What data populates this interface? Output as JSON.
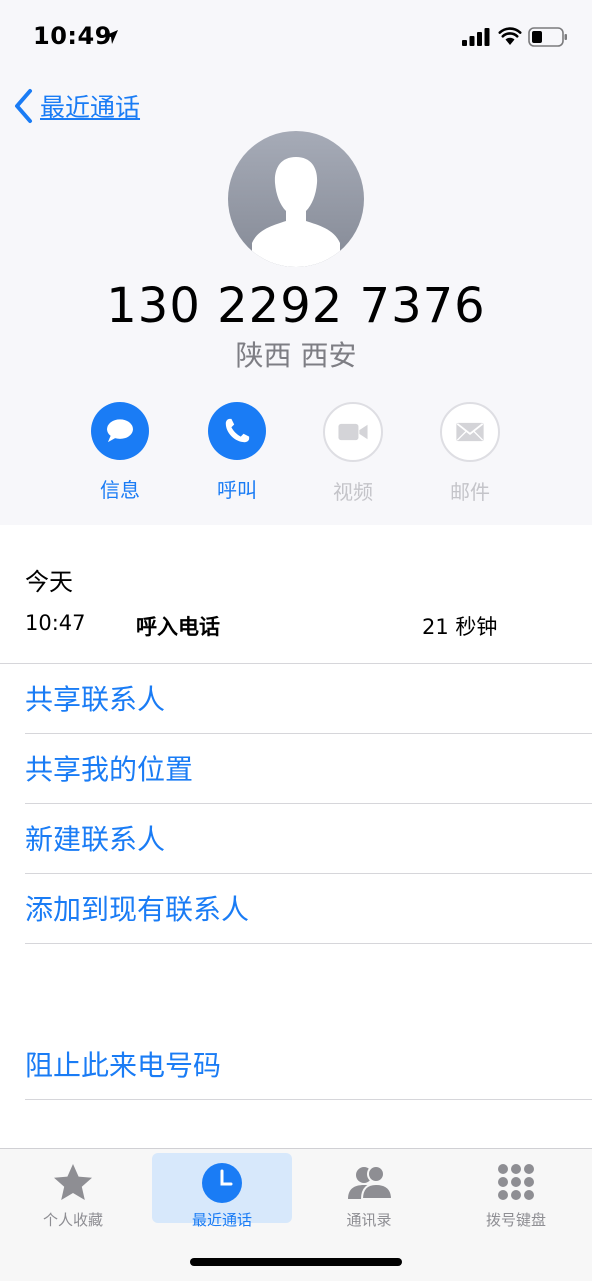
{
  "status": {
    "time": "10:49"
  },
  "nav": {
    "back_label": "最近通话"
  },
  "contact": {
    "number": "130 2292 7376",
    "location": "陕西 西安"
  },
  "actions": [
    {
      "label": "信息",
      "icon": "message-icon",
      "enabled": true
    },
    {
      "label": "呼叫",
      "icon": "phone-icon",
      "enabled": true
    },
    {
      "label": "视频",
      "icon": "video-icon",
      "enabled": false
    },
    {
      "label": "邮件",
      "icon": "mail-icon",
      "enabled": false
    }
  ],
  "call_log": {
    "day": "今天",
    "time": "10:47",
    "type": "呼入电话",
    "duration": "21 秒钟"
  },
  "options": [
    "共享联系人",
    "共享我的位置",
    "新建联系人",
    "添加到现有联系人"
  ],
  "block_label": "阻止此来电号码",
  "tabs": [
    {
      "label": "个人收藏",
      "icon": "star-icon",
      "active": false
    },
    {
      "label": "最近通话",
      "icon": "clock-icon",
      "active": true
    },
    {
      "label": "通讯录",
      "icon": "contacts-icon",
      "active": false
    },
    {
      "label": "拨号键盘",
      "icon": "keypad-icon",
      "active": false
    }
  ],
  "colors": {
    "accent": "#1a7cf5",
    "disabled": "#c4c4c9",
    "secondary_text": "#7e7e84",
    "top_background": "#f7f7fa"
  }
}
